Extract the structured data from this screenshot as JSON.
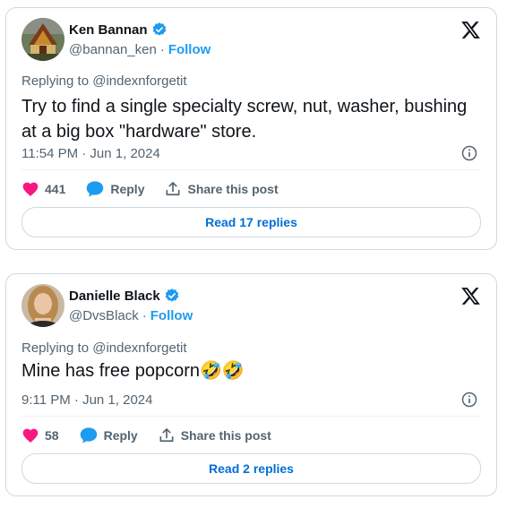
{
  "posts": [
    {
      "name": "Ken Bannan",
      "handle": "@bannan_ken",
      "separator": "·",
      "follow_label": "Follow",
      "replying_to": "Replying to @indexnforgetit",
      "text": "Try to find a single specialty screw, nut, washer, bushing at a big box \"hardware\" store.",
      "timestamp": "11:54 PM · Jun 1, 2024",
      "likes": "441",
      "reply_label": "Reply",
      "share_label": "Share this post",
      "read_replies_label": "Read 17 replies"
    },
    {
      "name": "Danielle Black",
      "handle": "@DvsBlack",
      "separator": "·",
      "follow_label": "Follow",
      "replying_to": "Replying to @indexnforgetit",
      "text": "Mine has free popcorn🤣🤣",
      "timestamp": "9:11 PM · Jun 1, 2024",
      "likes": "58",
      "reply_label": "Reply",
      "share_label": "Share this post",
      "read_replies_label": "Read 2 replies"
    }
  ],
  "colors": {
    "like": "#f91880",
    "reply_bubble": "#1d9bf0",
    "verified": "#1d9bf0",
    "link": "#1d9bf0",
    "button_text": "#006fd6"
  },
  "icons": [
    "verified-badge-icon",
    "x-logo-icon",
    "info-icon",
    "heart-icon",
    "reply-bubble-icon",
    "share-icon"
  ]
}
